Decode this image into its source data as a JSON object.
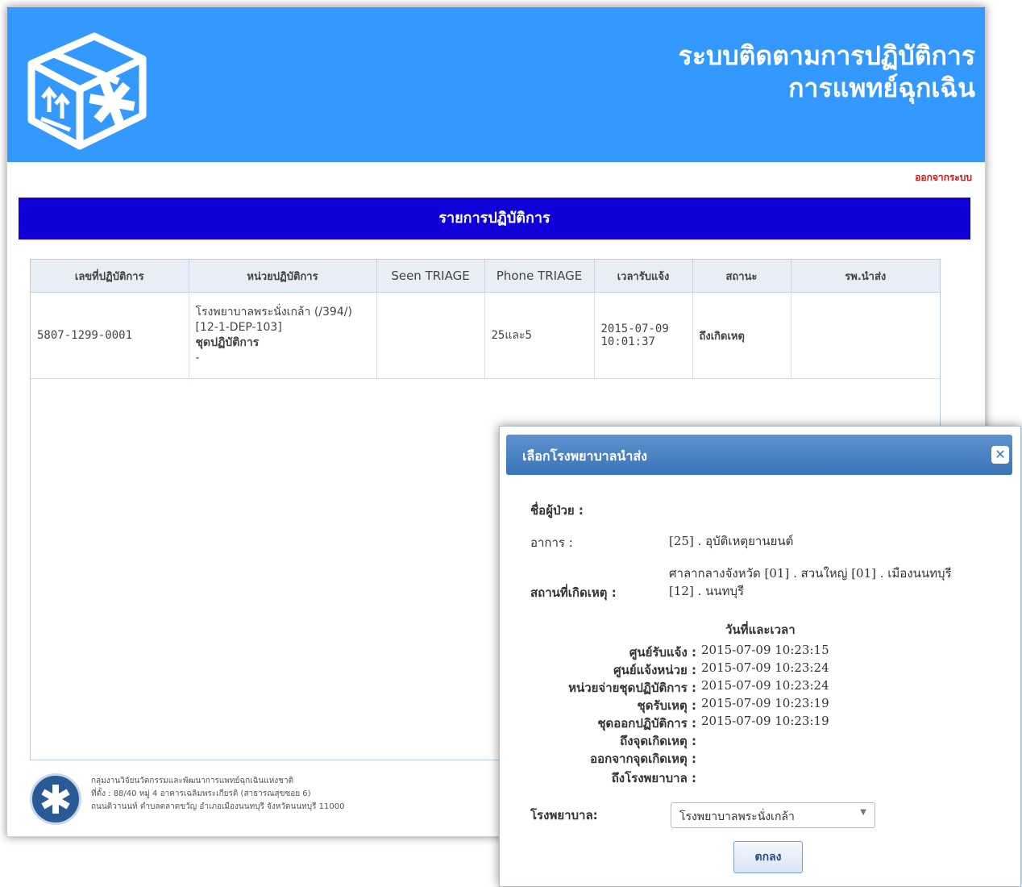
{
  "header": {
    "title_line1": "ระบบติดตามการปฏิบัติการ",
    "title_line2": "การแพทย์ฉุกเฉิน",
    "logout_label": "ออกจากระบบ"
  },
  "section_title": "รายการปฏิบัติการ",
  "table": {
    "columns": [
      "เลขที่ปฏิบัติการ",
      "หน่วยปฏิบัติการ",
      "Seen TRIAGE",
      "Phone TRIAGE",
      "เวลารับแจ้ง",
      "สถานะ",
      "รพ.นำส่ง"
    ],
    "rows": [
      {
        "op_number": "5807-1299-0001",
        "unit_line1": "โรงพยาบาลพระนั่งเกล้า (/394/)",
        "unit_line2": "[12-1-DEP-103]",
        "unit_line3": "ชุดปฏิบัติการ",
        "unit_line4": "-",
        "seen_triage": "",
        "phone_triage": "25และ5",
        "received_date": "2015-07-09",
        "received_time": "10:01:37",
        "status": "ถึงเกิดเหตุ",
        "hospital": ""
      }
    ]
  },
  "footer": {
    "line1": "กลุ่มงานวิจัยนวัตกรรมและพัฒนาการแพทย์ฉุกเฉินแห่งชาติ",
    "line2": "ที่ตั้ง : 88/40 หมู่ 4 อาคารเฉลิมพระเกียรติ (สาธารณสุขซอย 6)",
    "line3": "ถนนติวานนท์ ตำบลตลาดขวัญ อำเภอเมืองนนทบุรี จังหวัดนนทบุรี 11000"
  },
  "dialog": {
    "title": "เลือกโรงพยาบาลนำส่ง",
    "close_glyph": "✕",
    "patient_label": "ชื่อผู้ป่วย :",
    "symptom_label": "อาการ :",
    "symptom_value": "[25] . อุบัติเหตุยานยนต์",
    "location_label": "สถานที่เกิดเหตุ :",
    "location_line1": "ศาลากลางจังหวัด [01] . สวนใหญ่ [01] . เมืองนนทบุรี",
    "location_line2": "[12] . นนทบุรี",
    "datetime_heading": "วันที่และเวลา",
    "datetimes": [
      {
        "label": "ศูนย์รับแจ้ง :",
        "value": "2015-07-09 10:23:15"
      },
      {
        "label": "ศูนย์แจ้งหน่วย :",
        "value": "2015-07-09 10:23:24"
      },
      {
        "label": "หน่วยจ่ายชุดปฏิบัติการ :",
        "value": "2015-07-09 10:23:24"
      },
      {
        "label": "ชุดรับเหตุ :",
        "value": "2015-07-09 10:23:19"
      },
      {
        "label": "ชุดออกปฏิบัติการ :",
        "value": "2015-07-09 10:23:19"
      },
      {
        "label": "ถึงจุดเกิดเหตุ :",
        "value": ""
      },
      {
        "label": "ออกจากจุดเกิดเหตุ :",
        "value": ""
      },
      {
        "label": "ถึงโรงพยาบาล :",
        "value": ""
      }
    ],
    "hospital_label": "โรงพยาบาล:",
    "hospital_selected": "โรงพยาบาลพระนั่งเกล้า",
    "ok_label": "ตกลง"
  },
  "colors": {
    "header_blue": "#3399ff",
    "section_bar": "#0f00d8",
    "logout_red": "#dd1111",
    "dialog_title": "#3a73b7"
  },
  "icons": {
    "logo": "package-box-star-of-life-icon",
    "footer_logo": "ems-emblem-icon",
    "close": "close-icon",
    "select_chevron": "chevron-down-icon"
  }
}
